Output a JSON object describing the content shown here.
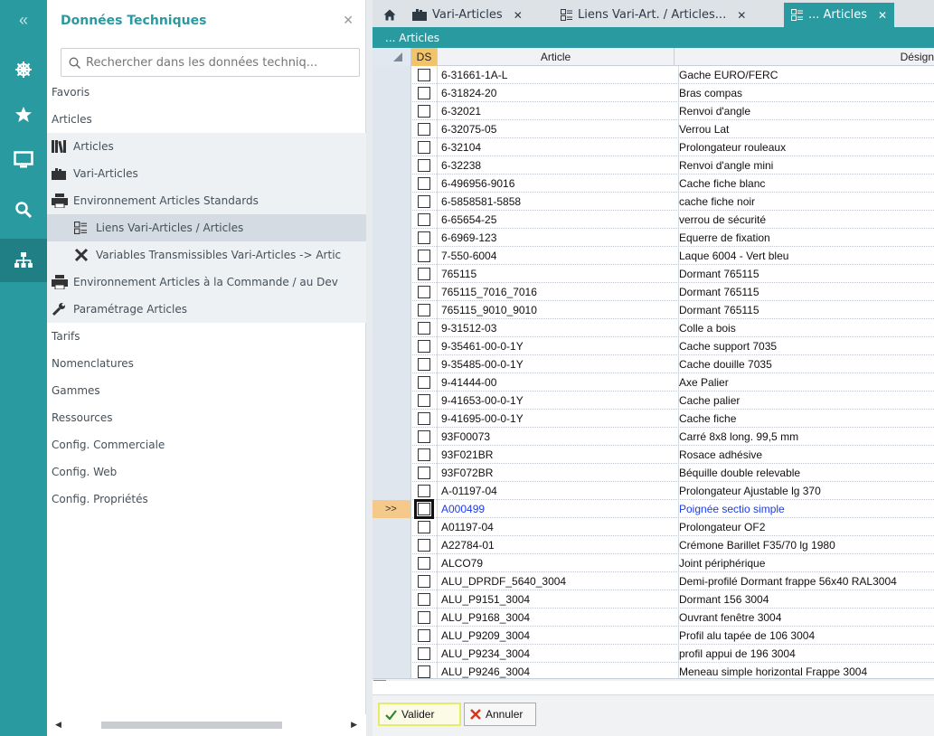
{
  "sidebar": {
    "title": "Données Techniques",
    "search_placeholder": "Rechercher dans les données techniq...",
    "items": [
      {
        "label": "Favoris",
        "level": 0
      },
      {
        "label": "Articles",
        "level": 0
      },
      {
        "label": "Articles",
        "level": 1,
        "icon": "books-icon"
      },
      {
        "label": "Vari-Articles",
        "level": 1,
        "icon": "folder-cards-icon"
      },
      {
        "label": "Environnement Articles Standards",
        "level": 1,
        "icon": "printer-environment-icon"
      },
      {
        "label": "Liens Vari-Articles / Articles",
        "level": 2,
        "icon": "grid-list-icon",
        "selected": true
      },
      {
        "label": "Variables Transmissibles Vari-Articles -> Artic",
        "level": 2,
        "icon": "tools-cross-icon"
      },
      {
        "label": "Environnement Articles à la Commande / au Dev",
        "level": 1,
        "icon": "printer-order-icon"
      },
      {
        "label": "Paramétrage Articles",
        "level": 1,
        "icon": "wrench-icon"
      },
      {
        "label": "Tarifs",
        "level": 0
      },
      {
        "label": "Nomenclatures",
        "level": 0
      },
      {
        "label": "Gammes",
        "level": 0
      },
      {
        "label": "Ressources",
        "level": 0
      },
      {
        "label": "Config. Commerciale",
        "level": 0
      },
      {
        "label": "Config. Web",
        "level": 0
      },
      {
        "label": "Config. Propriétés",
        "level": 0
      }
    ]
  },
  "tabs": [
    {
      "label": "Vari-Articles",
      "active": false
    },
    {
      "label": "Liens Vari-Art. / Articles...",
      "active": false
    },
    {
      "label": "... Articles",
      "active": true
    }
  ],
  "grid": {
    "title": "... Articles",
    "columns": {
      "ds": "DS",
      "article": "Article",
      "designation": "Désign"
    },
    "current_marker": ">>",
    "rows": [
      {
        "article": "6-31661-1A-L",
        "designation": "Gache EURO/FERC"
      },
      {
        "article": "6-31824-20",
        "designation": "Bras compas"
      },
      {
        "article": "6-32021",
        "designation": "Renvoi d'angle"
      },
      {
        "article": "6-32075-05",
        "designation": "Verrou Lat"
      },
      {
        "article": "6-32104",
        "designation": "Prolongateur rouleaux"
      },
      {
        "article": "6-32238",
        "designation": "Renvoi d'angle mini"
      },
      {
        "article": "6-496956-9016",
        "designation": "Cache fiche blanc"
      },
      {
        "article": "6-5858581-5858",
        "designation": "cache fiche noir"
      },
      {
        "article": "6-65654-25",
        "designation": "verrou de sécurité"
      },
      {
        "article": "6-6969-123",
        "designation": "Equerre de fixation"
      },
      {
        "article": "7-550-6004",
        "designation": "Laque 6004 - Vert bleu"
      },
      {
        "article": "765115",
        "designation": "Dormant 765115"
      },
      {
        "article": "765115_7016_7016",
        "designation": "Dormant 765115"
      },
      {
        "article": "765115_9010_9010",
        "designation": "Dormant 765115"
      },
      {
        "article": "9-31512-03",
        "designation": "Colle a bois"
      },
      {
        "article": "9-35461-00-0-1Y",
        "designation": "Cache support 7035"
      },
      {
        "article": "9-35485-00-0-1Y",
        "designation": "Cache douille 7035"
      },
      {
        "article": "9-41444-00",
        "designation": "Axe Palier"
      },
      {
        "article": "9-41653-00-0-1Y",
        "designation": "Cache palier"
      },
      {
        "article": "9-41695-00-0-1Y",
        "designation": "Cache fiche"
      },
      {
        "article": "93F00073",
        "designation": "Carré 8x8 long. 99,5 mm"
      },
      {
        "article": "93F021BR",
        "designation": "Rosace adhésive"
      },
      {
        "article": "93F072BR",
        "designation": "Béquille double relevable"
      },
      {
        "article": "A-01197-04",
        "designation": "Prolongateur Ajustable lg 370"
      },
      {
        "article": "A000499",
        "designation": "Poignée sectio simple",
        "current": true
      },
      {
        "article": "A01197-04",
        "designation": "Prolongateur OF2"
      },
      {
        "article": "A22784-01",
        "designation": "Crémone Barillet F35/70 lg 1980"
      },
      {
        "article": "ALCO79",
        "designation": "Joint périphérique"
      },
      {
        "article": "ALU_DPRDF_5640_3004",
        "designation": "Demi-profilé Dormant frappe 56x40 RAL3004"
      },
      {
        "article": "ALU_P9151_3004",
        "designation": "Dormant 156 3004"
      },
      {
        "article": "ALU_P9168_3004",
        "designation": "Ouvrant fenêtre 3004"
      },
      {
        "article": "ALU_P9209_3004",
        "designation": "Profil alu tapée de 106 3004"
      },
      {
        "article": "ALU_P9234_3004",
        "designation": "profil appui de 196 3004"
      },
      {
        "article": "ALU_P9246_3004",
        "designation": "Meneau simple horizontal Frappe 3004"
      }
    ]
  },
  "footer": {
    "valider": "Valider",
    "annuler": "Annuler"
  },
  "colors": {
    "accent": "#2a9aa1",
    "current_row_text": "#1a3cf0",
    "current_marker_bg": "#f5c98a"
  }
}
